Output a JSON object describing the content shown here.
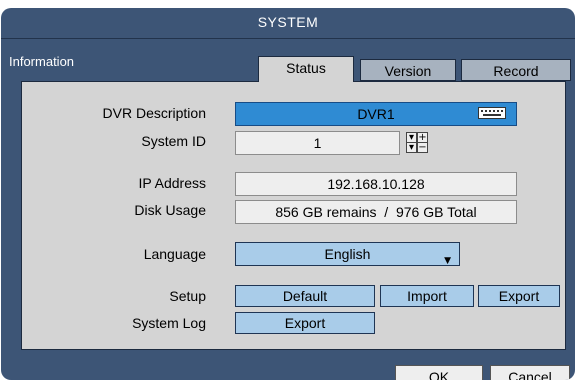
{
  "window": {
    "title": "SYSTEM"
  },
  "section": {
    "label": "Information"
  },
  "tabs": [
    {
      "label": "Status",
      "active": true
    },
    {
      "label": "Version",
      "active": false
    },
    {
      "label": "Record",
      "active": false
    }
  ],
  "fields": {
    "dvr_description": {
      "label": "DVR Description",
      "value": "DVR1",
      "icon": "keyboard-icon"
    },
    "system_id": {
      "label": "System ID",
      "value": "1"
    },
    "ip_address": {
      "label": "IP Address",
      "value": "192.168.10.128"
    },
    "disk_usage": {
      "label": "Disk Usage",
      "value": "856 GB remains  /  976 GB Total"
    },
    "language": {
      "label": "Language",
      "value": "English"
    }
  },
  "spin": {
    "up": "+",
    "down": "−"
  },
  "setup": {
    "label": "Setup",
    "default": "Default",
    "import": "Import",
    "export": "Export"
  },
  "system_log": {
    "label": "System Log",
    "export": "Export"
  },
  "footer": {
    "ok": "OK",
    "cancel": "Cancel"
  },
  "colors": {
    "window_bg": "#3d5576",
    "panel_bg": "#d4d4d4",
    "highlight": "#2f8bd3",
    "button": "#a9cce9"
  }
}
